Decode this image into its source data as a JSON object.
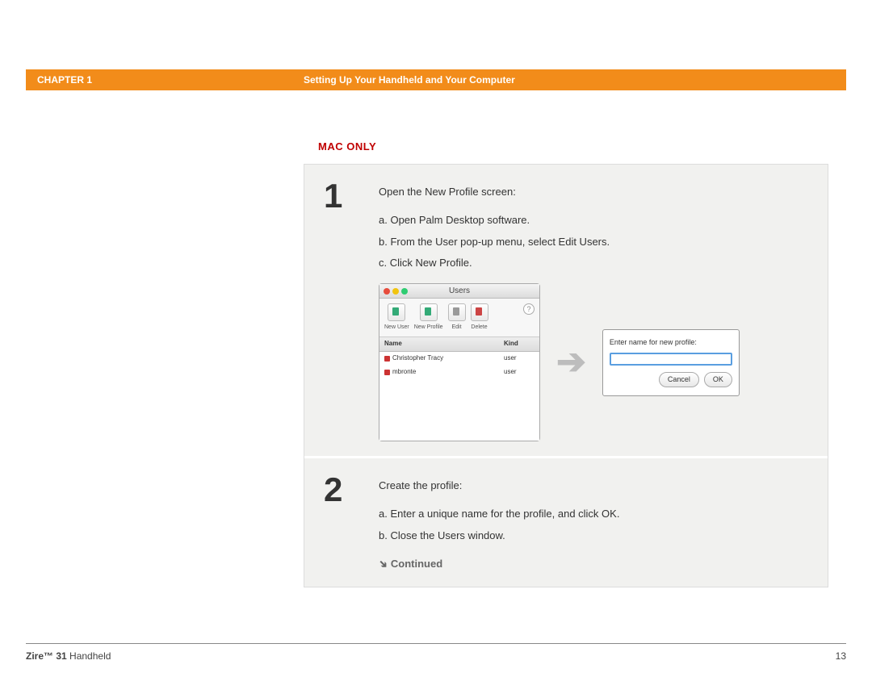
{
  "header": {
    "chapter": "CHAPTER 1",
    "title": "Setting Up Your Handheld and Your Computer"
  },
  "section_label": "MAC ONLY",
  "steps": [
    {
      "number": "1",
      "intro": "Open the New Profile screen:",
      "subs": [
        "a.  Open Palm Desktop software.",
        "b.  From the User pop-up menu, select Edit Users.",
        "c.  Click New Profile."
      ]
    },
    {
      "number": "2",
      "intro": "Create the profile:",
      "subs": [
        "a.  Enter a unique name for the profile, and click OK.",
        "b.  Close the Users window."
      ]
    }
  ],
  "users_window": {
    "title": "Users",
    "toolbar": [
      "New User",
      "New Profile",
      "Edit",
      "Delete"
    ],
    "columns": [
      "Name",
      "Kind"
    ],
    "rows": [
      {
        "name": "Christopher Tracy",
        "kind": "user"
      },
      {
        "name": "mbronte",
        "kind": "user"
      }
    ]
  },
  "profile_dialog": {
    "label": "Enter name for new profile:",
    "cancel": "Cancel",
    "ok": "OK"
  },
  "continued": "Continued",
  "footer": {
    "product_bold": "Zire™ 31",
    "product_rest": " Handheld",
    "page": "13"
  }
}
